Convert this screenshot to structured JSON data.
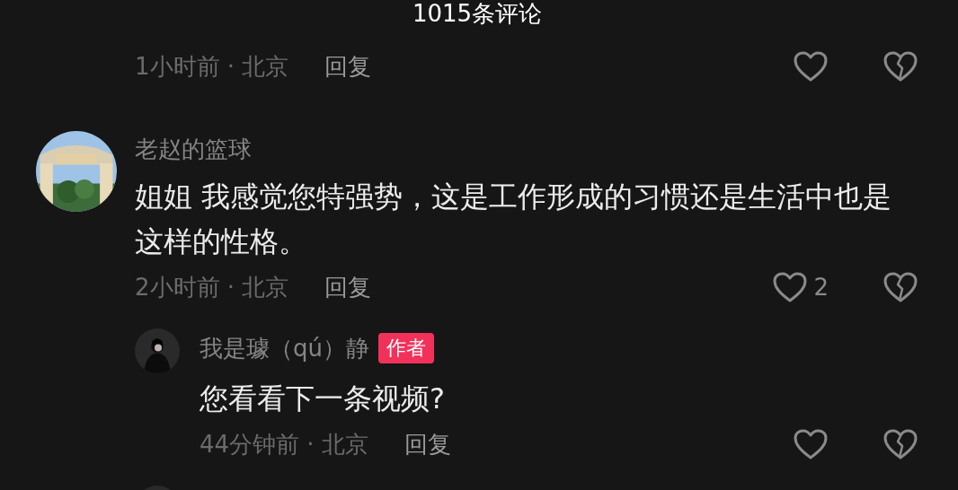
{
  "header": {
    "title": "1015条评论"
  },
  "comments": [
    {
      "meta": "1小时前 · 北京",
      "reply_label": "回复"
    },
    {
      "avatar": {
        "kind": "picture"
      },
      "username": "老赵的篮球",
      "content": "姐姐 我感觉您特强势，这是工作形成的习惯还是生活中也是这样的性格。",
      "meta": "2小时前 · 北京",
      "reply_label": "回复",
      "like_count": "2",
      "replies": [
        {
          "avatar": {
            "kind": "picture"
          },
          "username": "我是璩（qú）静",
          "badge": "作者",
          "content": "您看看下一条视频?",
          "meta": "44分钟前 · 北京",
          "reply_label": "回复"
        },
        {
          "avatar": {
            "kind": "picture"
          }
        }
      ]
    }
  ]
}
